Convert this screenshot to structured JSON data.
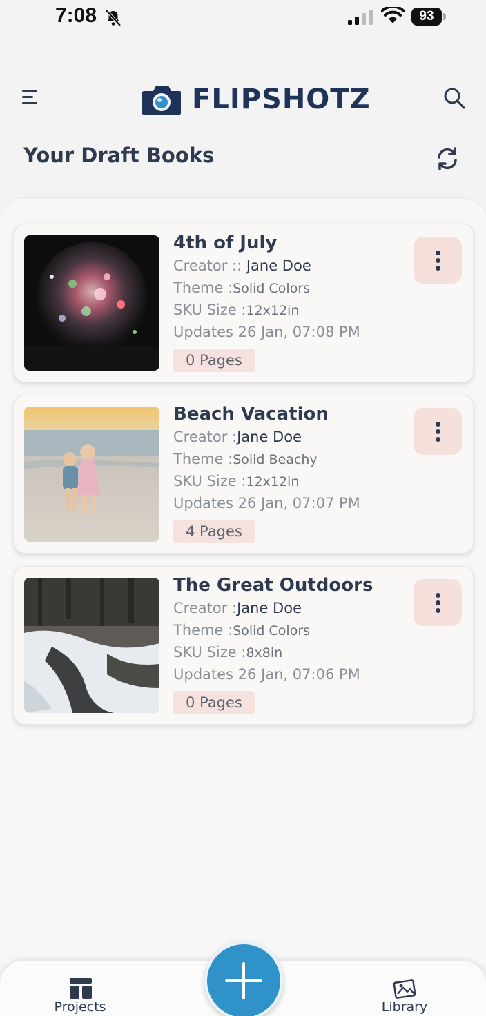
{
  "status_bar": {
    "time": "7:08",
    "battery": "93"
  },
  "header": {
    "logo_text": "FLIPSHOTZ",
    "section_title": "Your Draft Books"
  },
  "books": [
    {
      "title": "4th of July",
      "creator_label": "Creator :: ",
      "creator": "Jane Doe",
      "theme_label": "Theme :",
      "theme": "Solid Colors",
      "sku_label": "SKU Size :",
      "sku": "12x12in",
      "updates": "Updates 26 Jan, 07:08 PM",
      "pages": "0 Pages",
      "thumbnail": "fireworks-photo"
    },
    {
      "title": "Beach Vacation",
      "creator_label": "Creator :",
      "creator": "Jane Doe",
      "theme_label": "Theme :",
      "theme": "Soiid Beachy",
      "sku_label": "SKU Size :",
      "sku": "12x12in",
      "updates": "Updates 26 Jan, 07:07 PM",
      "pages": "4 Pages",
      "thumbnail": "beach-kids-photo"
    },
    {
      "title": "The Great Outdoors",
      "creator_label": "Creator :",
      "creator": "Jane Doe",
      "theme_label": "Theme :",
      "theme": "Solid Colors",
      "sku_label": "SKU Size :",
      "sku": "8x8in",
      "updates": "Updates 26 Jan, 07:06 PM",
      "pages": "0 Pages",
      "thumbnail": "snowy-creek-photo"
    }
  ],
  "nav": {
    "projects": "Projects",
    "library": "Library"
  },
  "colors": {
    "accent": "#2f93c9",
    "brand_navy": "#1f3258",
    "badge_bg": "#f5e2de"
  }
}
